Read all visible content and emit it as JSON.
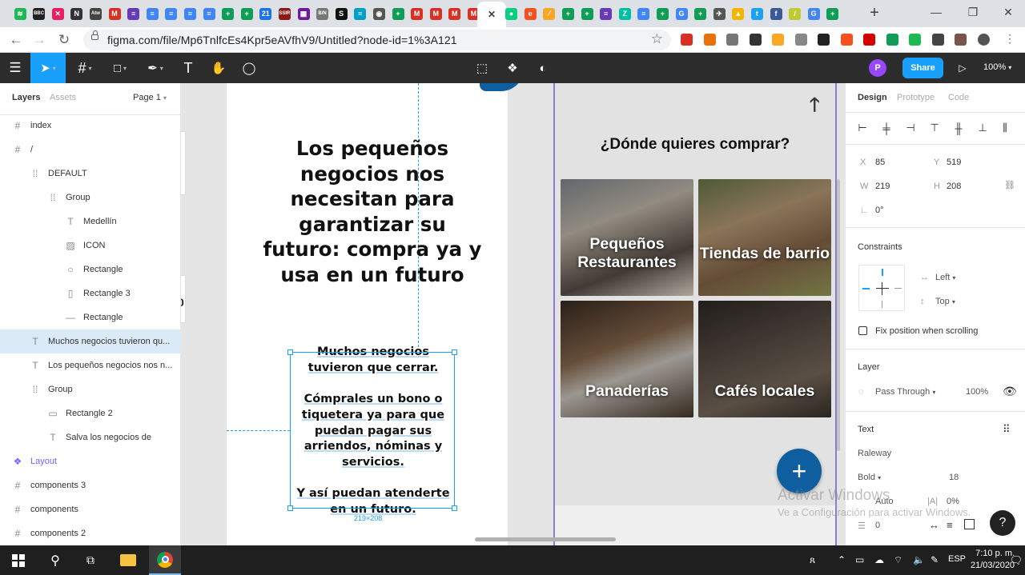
{
  "browser": {
    "tabs": [
      {
        "icon": "spotify-icon",
        "color": "#1db954",
        "glyph": "≋"
      },
      {
        "icon": "bbc-icon",
        "color": "#222222",
        "glyph": "BBC"
      },
      {
        "icon": "app-x-icon",
        "color": "#e91e63",
        "glyph": "✕"
      },
      {
        "icon": "app-n-icon",
        "color": "#333333",
        "glyph": "N"
      },
      {
        "icon": "app-atw-icon",
        "color": "#444444",
        "glyph": "Atw"
      },
      {
        "icon": "gmail-icon",
        "color": "#d93025",
        "glyph": "M"
      },
      {
        "icon": "forms-icon",
        "color": "#673ab7",
        "glyph": "≡"
      },
      {
        "icon": "docs-icon",
        "color": "#4285f4",
        "glyph": "≡"
      },
      {
        "icon": "docs-icon",
        "color": "#4285f4",
        "glyph": "≡"
      },
      {
        "icon": "docs-icon",
        "color": "#4285f4",
        "glyph": "≡"
      },
      {
        "icon": "docs-icon",
        "color": "#4285f4",
        "glyph": "≡"
      },
      {
        "icon": "sheets-plus-icon",
        "color": "#0f9d58",
        "glyph": "+"
      },
      {
        "icon": "sheets-plus-icon",
        "color": "#0f9d58",
        "glyph": "+"
      },
      {
        "icon": "calendar-21-icon",
        "color": "#1a73e8",
        "glyph": "21"
      },
      {
        "icon": "ssir-icon",
        "color": "#8b1a1a",
        "glyph": "SSIR"
      },
      {
        "icon": "app-grid-icon",
        "color": "#6a1b9a",
        "glyph": "▦"
      },
      {
        "icon": "app-bn-icon",
        "color": "#777777",
        "glyph": "B/N"
      },
      {
        "icon": "app-s-icon",
        "color": "#111111",
        "glyph": "S"
      },
      {
        "icon": "app-wave-icon",
        "color": "#00a0c6",
        "glyph": "≈"
      },
      {
        "icon": "app-circle-icon",
        "color": "#555555",
        "glyph": "◉"
      },
      {
        "icon": "sheets-plus-icon",
        "color": "#0f9d58",
        "glyph": "+"
      },
      {
        "icon": "gmail-icon",
        "color": "#d93025",
        "glyph": "M"
      },
      {
        "icon": "gmail-icon",
        "color": "#d93025",
        "glyph": "M"
      },
      {
        "icon": "gmail-icon",
        "color": "#d93025",
        "glyph": "M"
      },
      {
        "icon": "gmail-icon",
        "color": "#d93025",
        "glyph": "M"
      },
      {
        "icon": "close-tab-icon",
        "color": "#ffffff",
        "glyph": "✕",
        "active": true
      },
      {
        "icon": "app-green-dot-icon",
        "color": "#0acf83",
        "glyph": "●"
      },
      {
        "icon": "app-e-icon",
        "color": "#f4511e",
        "glyph": "e"
      },
      {
        "icon": "app-slash-icon",
        "color": "#f9a825",
        "glyph": "⁄"
      },
      {
        "icon": "sheets-plus-icon",
        "color": "#0f9d58",
        "glyph": "+"
      },
      {
        "icon": "sheets-plus-icon",
        "color": "#0f9d58",
        "glyph": "+"
      },
      {
        "icon": "forms-icon",
        "color": "#673ab7",
        "glyph": "≡"
      },
      {
        "icon": "app-z-icon",
        "color": "#00bfa5",
        "glyph": "Z"
      },
      {
        "icon": "docs-icon",
        "color": "#4285f4",
        "glyph": "≡"
      },
      {
        "icon": "sheets-plus-icon",
        "color": "#0f9d58",
        "glyph": "+"
      },
      {
        "icon": "google-icon",
        "color": "#4285f4",
        "glyph": "G"
      },
      {
        "icon": "sheets-plus-icon",
        "color": "#0f9d58",
        "glyph": "+"
      },
      {
        "icon": "app-bird-icon",
        "color": "#555555",
        "glyph": "✈"
      },
      {
        "icon": "drive-icon",
        "color": "#f4b400",
        "glyph": "▲"
      },
      {
        "icon": "twitter-icon",
        "color": "#1da1f2",
        "glyph": "t"
      },
      {
        "icon": "facebook-icon",
        "color": "#3b5998",
        "glyph": "f"
      },
      {
        "icon": "app-leaf-icon",
        "color": "#c0ca33",
        "glyph": "/"
      },
      {
        "icon": "google-icon",
        "color": "#4285f4",
        "glyph": "G"
      },
      {
        "icon": "sheets-plus-icon",
        "color": "#0f9d58",
        "glyph": "+"
      }
    ],
    "new_tab": "+",
    "url": "figma.com/file/Mp6TnlfcEs4Kpr5eAVfhV9/Untitled?node-id=1%3A121",
    "extensions": [
      "#d93025",
      "#e8710a",
      "#777777",
      "#333333",
      "#f9a825",
      "#888888",
      "#222222",
      "#f4511e",
      "#d50000",
      "#0f9d58",
      "#1db954",
      "#444444",
      "#795548",
      "#555555"
    ]
  },
  "toolbar": {
    "share": "Share",
    "zoom": "100%",
    "avatar": "P"
  },
  "layers": {
    "tab_layers": "Layers",
    "tab_assets": "Assets",
    "page": "Page 1",
    "rows": [
      {
        "icon": "#",
        "label": "index",
        "indent": 0,
        "type": "frame"
      },
      {
        "icon": "#",
        "label": "/",
        "indent": 0,
        "type": "frame"
      },
      {
        "icon": "⁞⁞",
        "label": "DEFAULT",
        "indent": 1,
        "type": "group"
      },
      {
        "icon": "⁞⁞",
        "label": "Group",
        "indent": 2,
        "type": "group"
      },
      {
        "icon": "T",
        "label": "Medellín",
        "indent": 3,
        "type": "text"
      },
      {
        "icon": "▨",
        "label": "ICON",
        "indent": 3,
        "type": "image"
      },
      {
        "icon": "○",
        "label": "Rectangle",
        "indent": 3,
        "type": "ellipse"
      },
      {
        "icon": "▯",
        "label": "Rectangle 3",
        "indent": 3,
        "type": "rect"
      },
      {
        "icon": "—",
        "label": "Rectangle",
        "indent": 3,
        "type": "line"
      },
      {
        "icon": "T",
        "label": "Muchos negocios tuvieron qu...",
        "indent": 1,
        "type": "text",
        "selected": true
      },
      {
        "icon": "T",
        "label": "Los pequeños negocios nos n...",
        "indent": 1,
        "type": "text"
      },
      {
        "icon": "⁞⁞",
        "label": "Group",
        "indent": 1,
        "type": "group"
      },
      {
        "icon": "▭",
        "label": "Rectangle 2",
        "indent": 2,
        "type": "rect"
      },
      {
        "icon": "T",
        "label": "Salva los negocios de",
        "indent": 2,
        "type": "text"
      },
      {
        "icon": "❖",
        "label": "Layout",
        "indent": 0,
        "type": "component"
      },
      {
        "icon": "#",
        "label": "components 3",
        "indent": 0,
        "type": "frame"
      },
      {
        "icon": "#",
        "label": "components",
        "indent": 0,
        "type": "frame"
      },
      {
        "icon": "#",
        "label": "components 2",
        "indent": 0,
        "type": "frame"
      }
    ]
  },
  "canvas": {
    "headline": "Los pequeños negocios nos necesitan para garantizar su futuro: compra ya y usa en un futuro",
    "body_lines": [
      "Muchos negocios",
      "tuvieron que cerrar.",
      "",
      "Cómprales un bono o",
      "tiquetera ya para que",
      "puedan pagar sus",
      "arriendos, nóminas y",
      "servicios.",
      "",
      "Y así puedan atenderte",
      "en un futuro."
    ],
    "selection_size": "219×208",
    "question": "¿Dónde quieres comprar?",
    "tiles": [
      {
        "label": "Pequeños Restaurantes",
        "icon": "restaurant-photo"
      },
      {
        "label": "Tiendas de barrio",
        "icon": "shop-photo"
      },
      {
        "label": "Panaderías",
        "icon": "bakery-photo"
      },
      {
        "label": "Cafés locales",
        "icon": "cafe-photo"
      }
    ],
    "fab": "+",
    "accent": "#0f5fa0"
  },
  "design": {
    "tab_design": "Design",
    "tab_prototype": "Prototype",
    "tab_code": "Code",
    "x_label": "X",
    "x": "85",
    "y_label": "Y",
    "y": "519",
    "w_label": "W",
    "w": "219",
    "h_label": "H",
    "h": "208",
    "rotation": "0°",
    "constraints_title": "Constraints",
    "constraint_h": "Left",
    "constraint_v": "Top",
    "fix_position": "Fix position when scrolling",
    "layer_title": "Layer",
    "blend": "Pass Through",
    "opacity": "100%",
    "text_title": "Text",
    "font": "Raleway",
    "weight": "Bold",
    "size": "18",
    "line_height": "Auto",
    "letter_spacing": "0%",
    "paragraph": "0"
  },
  "watermark": {
    "line1": "Activar Windows",
    "line2": "Ve a Configuración para activar Windows."
  },
  "taskbar": {
    "lang": "ESP",
    "time": "7:10 p. m.",
    "date": "21/03/2020"
  }
}
